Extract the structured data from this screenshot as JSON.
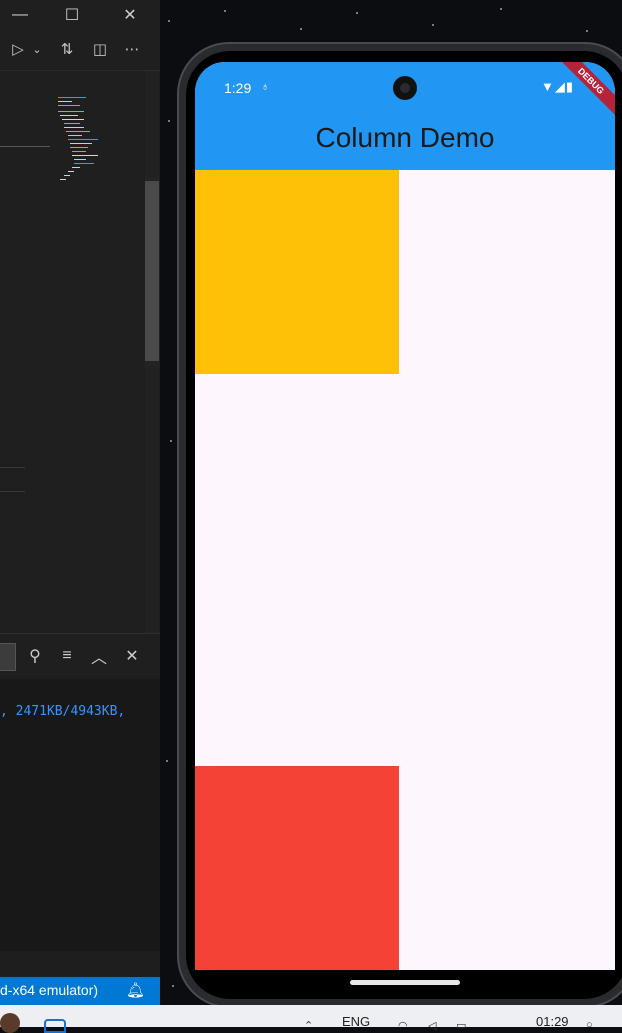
{
  "vscode": {
    "titlebar": {
      "restore_icon": "restore-icon",
      "close_icon": "close-icon"
    },
    "editor_actions": [
      "run-debug-icon",
      "chevron-down-icon",
      "source-control-icon",
      "split-editor-icon",
      "more-actions-icon"
    ],
    "panel": {
      "find_icon": "search-icon",
      "clear_icon": "clear-all-icon",
      "maximize_icon": "chevron-up-icon",
      "close_icon": "close-icon"
    },
    "terminal": {
      "line": ", 2471KB/4943KB,"
    },
    "statusbar": {
      "text": "d-x64 emulator)",
      "bell_icon": "bell-icon"
    }
  },
  "phone": {
    "status": {
      "time": "1:29",
      "notification_icon": "notification-icon",
      "icons": "wifi-icon signal-icon battery-icon"
    },
    "debug_banner": "DEBUG",
    "appbar": {
      "title": "Column Demo",
      "color": "#2196f3"
    },
    "boxes": [
      {
        "name": "yellow",
        "color": "#ffc107"
      },
      {
        "name": "red",
        "color": "#f44336"
      }
    ],
    "background": "#fdf7fd"
  },
  "taskbar": {
    "language": "ENG",
    "time": "01:29"
  }
}
